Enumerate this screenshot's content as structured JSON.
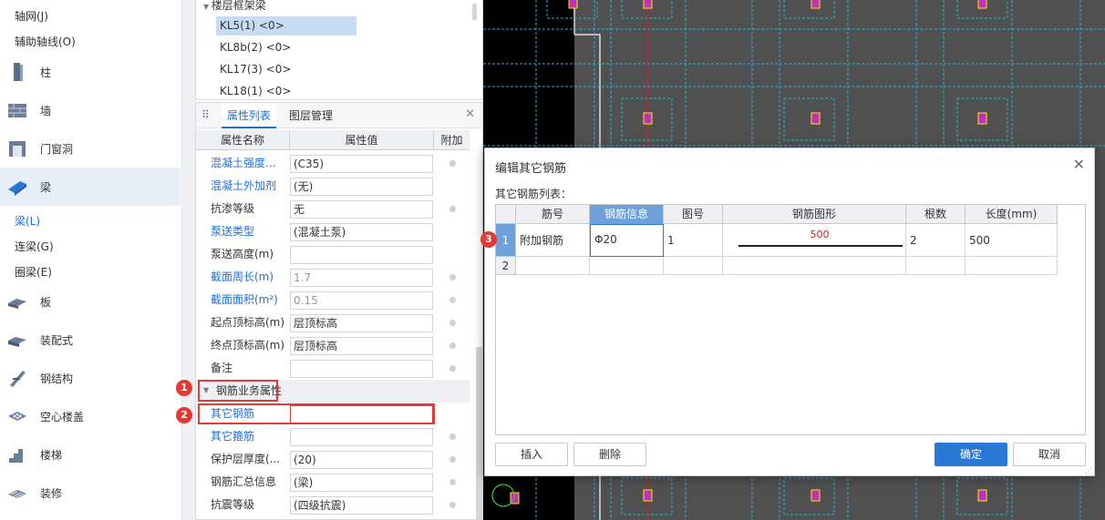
{
  "nav": {
    "sub_top": [
      "轴网(J)",
      "辅助轴线(O)"
    ],
    "items": [
      {
        "label": "柱",
        "icon": "column-icon"
      },
      {
        "label": "墙",
        "icon": "wall-icon"
      },
      {
        "label": "门窗洞",
        "icon": "door-window-icon"
      },
      {
        "label": "梁",
        "icon": "beam-icon",
        "selected": true
      },
      {
        "label": "板",
        "icon": "slab-icon"
      },
      {
        "label": "装配式",
        "icon": "prefab-icon"
      },
      {
        "label": "钢结构",
        "icon": "steel-structure-icon"
      },
      {
        "label": "空心楼盖",
        "icon": "hollow-floor-icon"
      },
      {
        "label": "楼梯",
        "icon": "stair-icon"
      },
      {
        "label": "装修",
        "icon": "decoration-icon"
      }
    ],
    "beam_subs": [
      "梁(L)",
      "连梁(G)",
      "圈梁(E)"
    ]
  },
  "tree": {
    "header": "楼层框架梁",
    "nodes": [
      "KL5(1) <0>",
      "KL8b(2) <0>",
      "KL17(3) <0>",
      "KL18(1) <0>"
    ]
  },
  "props": {
    "tabs": [
      "属性列表",
      "图层管理"
    ],
    "columns": [
      "属性名称",
      "属性值",
      "附加"
    ],
    "rows": [
      {
        "name": "混凝土强度...",
        "value": "(C35)",
        "blue": true
      },
      {
        "name": "混凝土外加剂",
        "value": "(无)",
        "blue": true
      },
      {
        "name": "抗渗等级",
        "value": "无"
      },
      {
        "name": "泵送类型",
        "value": "(混凝土泵)",
        "blue": true
      },
      {
        "name": "泵送高度(m)",
        "value": ""
      },
      {
        "name": "截面周长(m)",
        "value": "1.7",
        "blue": true,
        "gray": true
      },
      {
        "name": "截面面积(m²)",
        "value": "0.15",
        "blue": true,
        "gray": true
      },
      {
        "name": "起点顶标高(m)",
        "value": "层顶标高"
      },
      {
        "name": "终点顶标高(m)",
        "value": "层顶标高"
      },
      {
        "name": "备注",
        "value": ""
      }
    ],
    "group": "钢筋业务属性",
    "other_rebar": "其它钢筋",
    "rows2": [
      {
        "name": "其它箍筋",
        "value": "",
        "blue": true
      },
      {
        "name": "保护层厚度(...",
        "value": "(20)"
      },
      {
        "name": "钢筋汇总信息",
        "value": "(梁)"
      },
      {
        "name": "抗震等级",
        "value": "(四级抗震)"
      }
    ],
    "dots": "···"
  },
  "badges": [
    "1",
    "2",
    "3"
  ],
  "dialog": {
    "title": "编辑其它钢筋",
    "subtitle": "其它钢筋列表：",
    "columns": [
      "筋号",
      "钢筋信息",
      "图号",
      "钢筋图形",
      "根数",
      "长度(mm)"
    ],
    "rows": [
      {
        "no": "1",
        "jinhao": "附加钢筋",
        "info": "Φ20",
        "tuhao": "1",
        "shape_value": "500",
        "count": "2",
        "length": "500"
      },
      {
        "no": "2",
        "jinhao": "",
        "info": "",
        "tuhao": "",
        "shape_value": "",
        "count": "",
        "length": ""
      }
    ],
    "buttons": {
      "insert": "插入",
      "delete": "删除",
      "ok": "确定",
      "cancel": "取消"
    }
  },
  "colors": {
    "accent": "#1e6fd9",
    "highlight": "#6fa0da",
    "red": "#e53935",
    "cad_bg": "#505050",
    "cad_cyan": "#28b4d8",
    "cad_magenta": "#cc33cc"
  }
}
